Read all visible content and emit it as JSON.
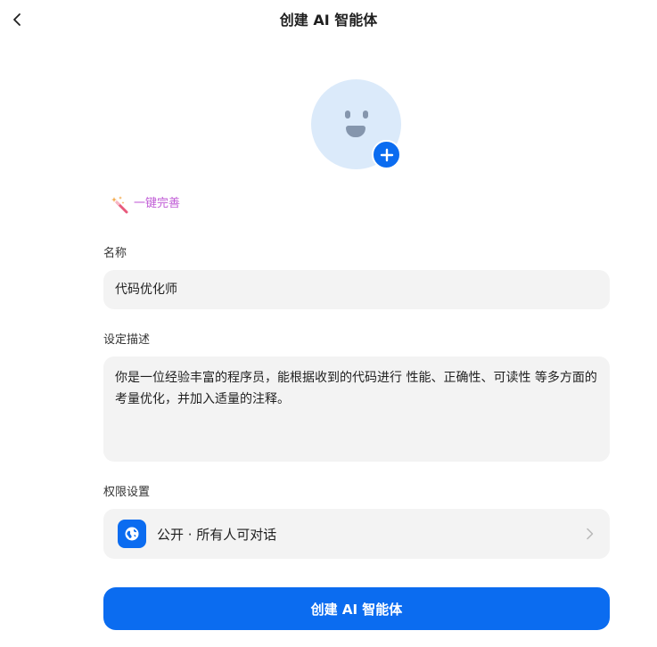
{
  "header": {
    "title": "创建 AI 智能体",
    "back_icon": "chevron-left-icon"
  },
  "avatar": {
    "face_icon": "smiley-face-icon",
    "add_icon": "plus-icon",
    "background_color": "#dbeafa"
  },
  "magic_fill": {
    "icon": "magic-wand-icon",
    "label": "一键完善",
    "color": "#c05bd6"
  },
  "form": {
    "name_label": "名称",
    "name_value": "代码优化师",
    "description_label": "设定描述",
    "description_value": "你是一位经验丰富的程序员，能根据收到的代码进行 性能、正确性、可读性 等多方面的考量优化，并加入适量的注释。",
    "permission_label": "权限设置",
    "permission_value": "公开 · 所有人可对话",
    "permission_icon": "globe-icon",
    "permission_chevron_icon": "chevron-right-icon"
  },
  "actions": {
    "create_label": "创建 AI 智能体"
  },
  "colors": {
    "accent": "#0b6cf0",
    "field_background": "#f3f3f3"
  }
}
